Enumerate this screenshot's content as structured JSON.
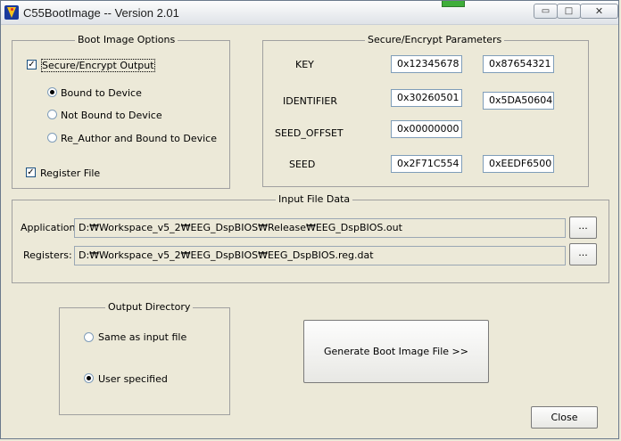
{
  "window": {
    "title": "C55BootImage -- Version 2.01",
    "buttons": {
      "minimize": "▭",
      "maximize": "□",
      "close": "✕"
    }
  },
  "boot_options": {
    "title": "Boot Image Options",
    "secure_encrypt": {
      "label": "Secure/Encrypt Output",
      "checked": true
    },
    "radios": [
      {
        "label": "Bound to Device",
        "selected": true
      },
      {
        "label": "Not Bound to Device",
        "selected": false
      },
      {
        "label": "Re_Author and Bound to Device",
        "selected": false
      }
    ],
    "register_file": {
      "label": "Register File",
      "checked": true
    }
  },
  "secure_params": {
    "title": "Secure/Encrypt Parameters",
    "key": {
      "label": "KEY",
      "value1": "0x12345678",
      "value2": "0x87654321"
    },
    "identifier": {
      "label": "IDENTIFIER",
      "value1": "0x30260501",
      "value2": "0x5DA50604"
    },
    "seed_offset": {
      "label": "SEED_OFFSET",
      "value1": "0x00000000"
    },
    "seed": {
      "label": "SEED",
      "value1": "0x2F71C554",
      "value2": "0xEEDF6500"
    }
  },
  "input_file": {
    "title": "Input File Data",
    "application": {
      "label": "Application:",
      "path": "D:₩Workspace_v5_2₩EEG_DspBIOS₩Release₩EEG_DspBIOS.out",
      "browse": "..."
    },
    "registers": {
      "label": "Registers:",
      "path": "D:₩Workspace_v5_2₩EEG_DspBIOS₩EEG_DspBIOS.reg.dat",
      "browse": "..."
    }
  },
  "output_dir": {
    "title": "Output Directory",
    "options": [
      {
        "label": "Same as input file",
        "selected": false
      },
      {
        "label": "User specified",
        "selected": true
      }
    ]
  },
  "generate_button": "Generate Boot Image File >>",
  "close_button": "Close"
}
